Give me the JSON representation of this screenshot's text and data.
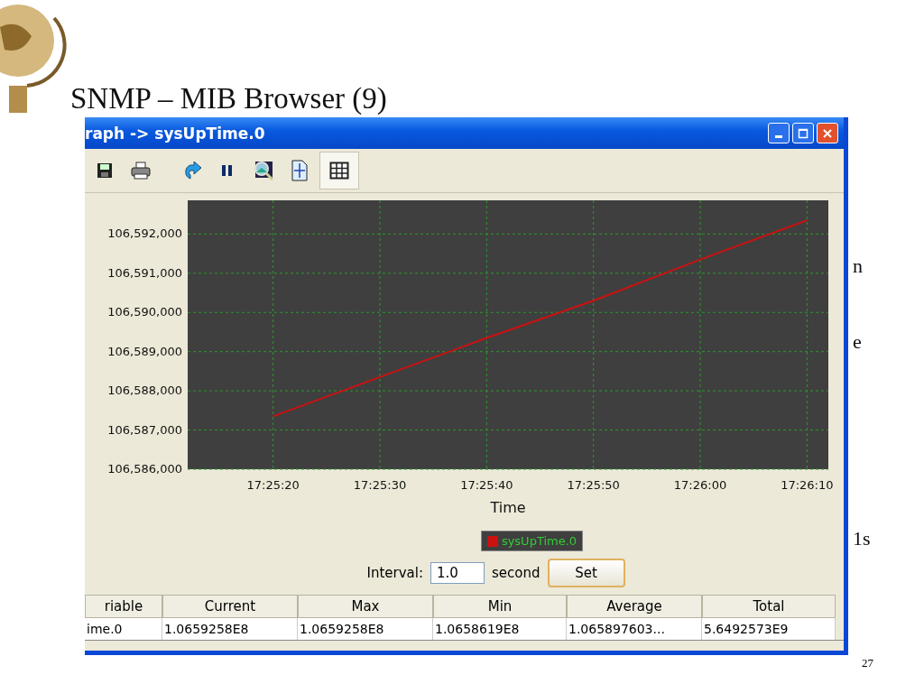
{
  "slide": {
    "title": "SNMP – MIB Browser (9)",
    "page_number": "27",
    "fragments": [
      "n",
      "e",
      "1s"
    ]
  },
  "window": {
    "title": "raph -> sysUpTime.0"
  },
  "toolbar": [
    {
      "kind": "save",
      "pressed": false
    },
    {
      "kind": "print",
      "pressed": false
    },
    {
      "kind": "refresh",
      "pressed": false
    },
    {
      "kind": "pause",
      "pressed": false
    },
    {
      "kind": "zoom",
      "pressed": false
    },
    {
      "kind": "fit",
      "pressed": false
    },
    {
      "kind": "grid",
      "pressed": true
    }
  ],
  "graph": {
    "chart_data": {
      "type": "line",
      "grid": true,
      "xlabel": "Time",
      "categories": [
        "17:25:20",
        "17:25:30",
        "17:25:40",
        "17:25:50",
        "17:26:00",
        "17:26:10"
      ],
      "ylim": [
        106586000,
        106592860
      ],
      "yticks": [
        {
          "value": 106586000,
          "label": "106,586,000"
        },
        {
          "value": 106587000,
          "label": "106,587,000"
        },
        {
          "value": 106588000,
          "label": "106,588,000"
        },
        {
          "value": 106589000,
          "label": "106,589,000"
        },
        {
          "value": 106590000,
          "label": "106,590,000"
        },
        {
          "value": 106591000,
          "label": "106,591,000"
        },
        {
          "value": 106592000,
          "label": "106,592,000"
        }
      ],
      "series": [
        {
          "name": "sysUpTime.0",
          "color": "#cc1111",
          "values": [
            106587350,
            106588350,
            106589350,
            106590300,
            106591350,
            106592350
          ]
        }
      ]
    }
  },
  "interval": {
    "label": "Interval:",
    "value": "1.0",
    "unit": "second",
    "button": "Set"
  },
  "table": {
    "columns": [
      "riable",
      "Current",
      "Max",
      "Min",
      "Average",
      "Total"
    ],
    "rows": [
      [
        "ime.0",
        "1.0659258E8",
        "1.0659258E8",
        "1.0658619E8",
        "1.065897603...",
        "5.6492573E9"
      ]
    ]
  }
}
